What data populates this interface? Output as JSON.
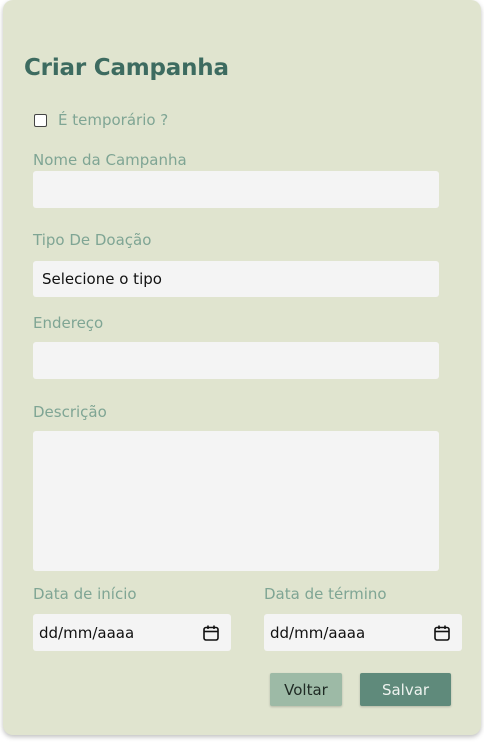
{
  "form": {
    "title": "Criar Campanha",
    "temporary_checkbox": {
      "label": "É temporário ?",
      "checked": false
    },
    "campaign_name": {
      "label": "Nome da Campanha",
      "value": ""
    },
    "donation_type": {
      "label": "Tipo De Doação",
      "selected": "Selecione o tipo"
    },
    "address": {
      "label": "Endereço",
      "value": ""
    },
    "description": {
      "label": "Descrição",
      "value": ""
    },
    "start_date": {
      "label": "Data de início",
      "placeholder": "dd/mm/aaaa"
    },
    "end_date": {
      "label": "Data de término",
      "placeholder": "dd/mm/aaaa"
    }
  },
  "actions": {
    "back_label": "Voltar",
    "save_label": "Salvar"
  },
  "icons": {
    "calendar": "calendar-icon"
  },
  "colors": {
    "card_background": "#e0e4cf",
    "title": "#3d6b60",
    "label": "#7fa594",
    "input_background": "#f4f4f4",
    "back_button": "#9dbaa6",
    "save_button": "#5f8a7b"
  }
}
